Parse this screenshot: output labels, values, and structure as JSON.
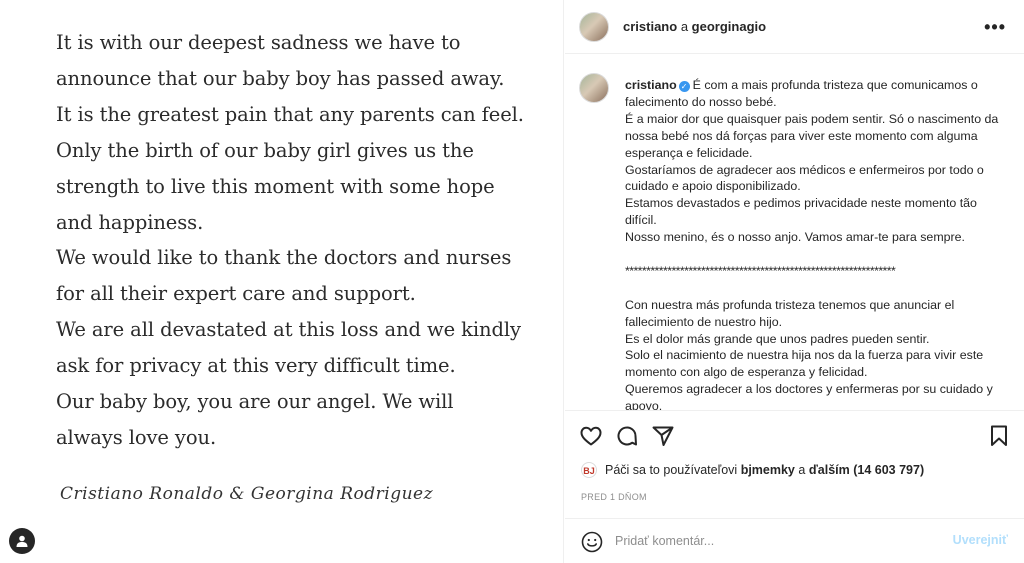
{
  "image": {
    "statement_lines": [
      "It is with our deepest sadness we have to",
      "announce that our baby boy has passed away.",
      "It is the greatest pain that any parents can feel.",
      "Only the birth of our baby girl gives us the",
      "strength to live this moment with some hope",
      "and happiness.",
      "We would like to thank the doctors and nurses",
      "for all their expert care and support.",
      "We are all devastated at this loss and we kindly",
      "ask for privacy at this very difficult time.",
      "Our baby boy, you are our angel. We will",
      "always love you."
    ],
    "signature": "Cristiano Ronaldo & Georgina Rodriguez",
    "user_tag_icon": "person-icon"
  },
  "header": {
    "username": "cristiano",
    "connector": "a",
    "collaborator": "georginagio",
    "more_icon": "more-horizontal-icon",
    "more_label": "•••"
  },
  "caption": {
    "username": "cristiano",
    "verified_icon": "verified-badge-icon",
    "verified_glyph": "✓",
    "first_line": "É com a mais profunda tristeza que comunicamos o",
    "lines": [
      "falecimento do nosso bebé.",
      "É a maior dor que quaisquer pais podem sentir. Só o nascimento da",
      "nossa bebé nos dá forças para viver este momento com alguma",
      "esperança e felicidade.",
      "Gostaríamos de agradecer aos médicos e enfermeiros por todo o",
      "cuidado e apoio disponibilizado.",
      "Estamos devastados e pedimos privacidade neste momento tão",
      "difícil.",
      "Nosso menino, és o nosso anjo. Vamos amar-te para sempre.",
      "",
      "****************************************************************",
      "",
      "Con nuestra más profunda tristeza tenemos que anunciar el",
      "fallecimiento de nuestro hijo.",
      "Es el dolor más grande que unos padres pueden sentir.",
      "Solo el nacimiento de nuestra hija nos da la fuerza para vivir este",
      "momento con algo de esperanza y felicidad.",
      "Queremos agradecer a los doctores y enfermeras por su cuidado y",
      "apoyo."
    ]
  },
  "actions": {
    "like_icon": "heart-icon",
    "comment_icon": "comment-icon",
    "share_icon": "send-icon",
    "save_icon": "bookmark-icon"
  },
  "likes": {
    "liker_badge": "BJ",
    "prefix": "Páči sa to používateľovi",
    "liker": "bjmemky",
    "conjunction": "a",
    "others": "ďalším (14 603 797)"
  },
  "timestamp": "PRED 1 DŇOM",
  "comment": {
    "emoji_icon": "emoji-icon",
    "placeholder": "Pridať komentár...",
    "post_label": "Uverejniť"
  }
}
